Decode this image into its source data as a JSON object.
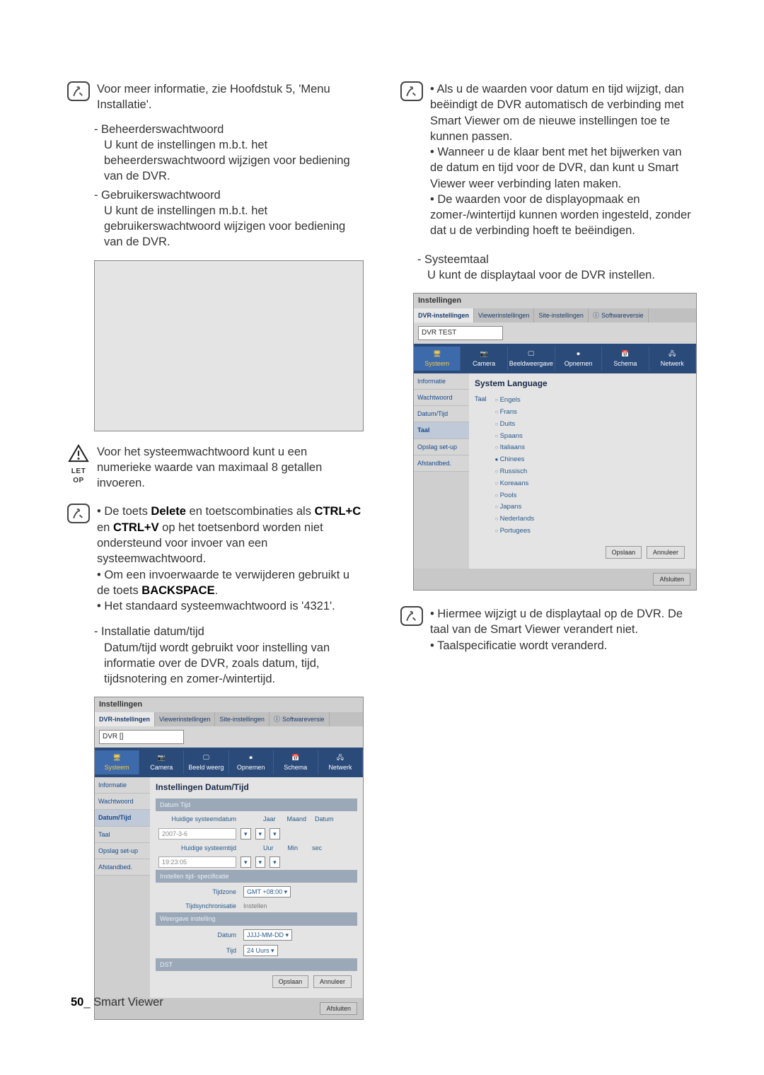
{
  "left": {
    "intro": "Voor meer informatie, zie Hoofdstuk 5, 'Menu Installatie'.",
    "beheer_title": "Beheerderswachtwoord",
    "beheer_body": "U kunt de instellingen m.b.t. het beheerderswachtwoord wijzigen voor bediening van de DVR.",
    "gebruiker_title": "Gebruikerswachtwoord",
    "gebruiker_body": "U kunt de instellingen m.b.t. het gebruikerswachtwoord wijzigen voor bediening van de DVR.",
    "letop_label": "LET OP",
    "letop_body": "Voor het systeemwachtwoord kunt u een numerieke waarde van maximaal 8 getallen invoeren.",
    "tip1_a": "De toets ",
    "tip1_del": "Delete",
    "tip1_b": " en toetscombinaties als ",
    "tip1_ctrlc": "CTRL+C",
    "tip1_c": " en ",
    "tip1_ctrlv": "CTRL+V",
    "tip1_d": " op het toetsenbord worden niet ondersteund voor invoer van een systeemwachtwoord.",
    "tip2_a": "Om een invoerwaarde te verwijderen gebruikt u de toets ",
    "tip2_back": "BACKSPACE",
    "tip2_b": ".",
    "tip3": "Het standaard systeemwachtwoord is '4321'.",
    "installatie_title": "Installatie datum/tijd",
    "installatie_body": "Datum/tijd wordt gebruikt voor instelling van informatie over de DVR, zoals datum, tijd, tijdsnotering en zomer-/wintertijd."
  },
  "right": {
    "b1": "Als u de waarden voor datum en tijd wijzigt, dan beëindigt de DVR automatisch de verbinding met Smart Viewer om de nieuwe instellingen toe te kunnen passen.",
    "b2": "Wanneer u de klaar bent met het bijwerken van de datum en tijd voor de DVR, dan kunt u Smart Viewer weer verbinding laten maken.",
    "b3": "De waarden voor de displayopmaak en zomer-/wintertijd kunnen worden ingesteld, zonder dat u de verbinding hoeft te beëindigen.",
    "systeemtaal_title": "Systeemtaal",
    "systeemtaal_body": "U kunt de displaytaal voor de DVR instellen.",
    "b4": "Hiermee wijzigt u de displaytaal op de DVR. De taal van de Smart Viewer verandert niet.",
    "b5": "Taalspecificatie wordt veranderd."
  },
  "ss_datetime": {
    "win_title": "Instellingen",
    "tab1": "DVR-instellingen",
    "tab2": "Viewerinstellingen",
    "tab3": "Site-instellingen",
    "tab4": "Softwareversie",
    "dropdown": "DVR []",
    "cats": [
      "Systeem",
      "Camera",
      "Beeld weerg",
      "Opnemen",
      "Schema",
      "Netwerk"
    ],
    "side": [
      "Informatie",
      "Wachtwoord",
      "Datum/Tijd",
      "Taal",
      "Opslag set-up",
      "Afstandbed."
    ],
    "panel_title": "Instellingen Datum/Tijd",
    "sec1": "Datum Tijd",
    "lbl_curdate": "Huidige systeemdatum",
    "val_curdate": "2007-3-6",
    "col_j": "Jaar",
    "col_m": "Maand",
    "col_d": "Datum",
    "lbl_curtime": "Huidige systeemtijd",
    "val_curtime": "19:23:05",
    "col_u": "Uur",
    "col_min": "Min",
    "col_s": "sec",
    "sec2": "Instellen tijd- specificatie",
    "lbl_tz": "Tijdzone",
    "val_tz": "GMT +08:00",
    "lbl_sync": "Tijdsynchronisatie",
    "val_sync": "Instellen",
    "sec3": "Weergave instelling",
    "lbl_date": "Datum",
    "val_date": "JJJJ-MM-DD",
    "lbl_time": "Tijd",
    "val_time": "24 Uurs",
    "sec4": "DST",
    "btn_apply": "Opslaan",
    "btn_cancel": "Annuleer",
    "btn_close": "Afsluiten"
  },
  "ss_lang": {
    "win_title": "Instellingen",
    "tab1": "DVR-instellingen",
    "tab2": "Viewerinstellingen",
    "tab3": "Site-instellingen",
    "tab4": "Softwareversie",
    "dropdown": "DVR TEST",
    "cats": [
      "Systeem",
      "Camera",
      "Beeldweergave",
      "Opnemen",
      "Schema",
      "Netwerk"
    ],
    "side": [
      "Informatie",
      "Wachtwoord",
      "Datum/Tijd",
      "Taal",
      "Opslag set-up",
      "Afstandbed."
    ],
    "panel_title": "System Language",
    "group": "Taal",
    "langs": [
      "Engels",
      "Frans",
      "Duits",
      "Spaans",
      "Italiaans",
      "Chinees",
      "Russisch",
      "Koreaans",
      "Pools",
      "Japans",
      "Nederlands",
      "Portugees"
    ],
    "sel_lang": "Chinees",
    "btn_apply": "Opslaan",
    "btn_cancel": "Annuleer",
    "btn_close": "Afsluiten"
  },
  "footer": {
    "page": "50",
    "label": "Smart Viewer",
    "sep": "_ "
  }
}
